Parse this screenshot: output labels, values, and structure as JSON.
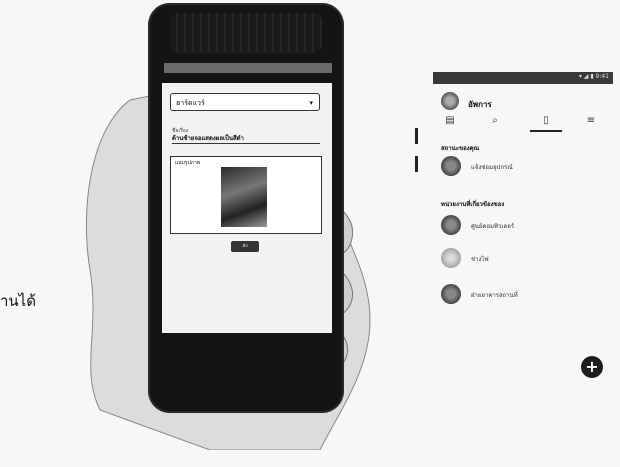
{
  "left_text": "านได้",
  "phone": {
    "dropdown_value": "ฮาร์ดแวร์",
    "dropdown_chevron": "▾",
    "field_label": "ชื่อเรื่อง",
    "field_value": "ด้านซ้ายจอแสดงผลเป็นสีดำ",
    "image_caption": "แนบรูปภาพ",
    "submit_label": "ส่ง"
  },
  "panel": {
    "status_right": "▾ ◢ ▮ 9:41",
    "app_title": "อัพการ",
    "tabs": [
      {
        "icon": "▤",
        "name": "tab-home-icon"
      },
      {
        "icon": "⌕",
        "name": "tab-search-icon"
      },
      {
        "icon": "▯",
        "name": "tab-device-icon"
      },
      {
        "icon": "≡",
        "name": "tab-menu-icon"
      }
    ],
    "section1": "สถานะของคุณ",
    "section1_items": [
      "แจ้งซ่อมอุปกรณ์"
    ],
    "section2": "หน่วยงานที่เกี่ยวข้องของ",
    "section2_items": [
      "ศูนย์คอมพิวเตอร์",
      "ช่างไฟ",
      "ฝ่ายอาคารสถานที่"
    ],
    "fab": "+"
  }
}
